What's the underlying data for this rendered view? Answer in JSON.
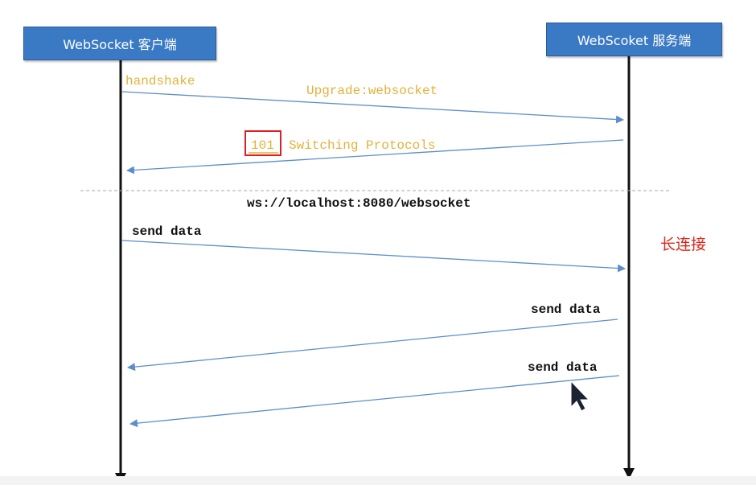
{
  "actors": {
    "client": "WebSocket 客户端",
    "server": "WebScoket 服务端"
  },
  "messages": {
    "handshake": "handshake",
    "upgrade": "Upgrade:websocket",
    "status_code": "101",
    "status_text": "Switching Protocols",
    "url": "ws://localhost:8080/websocket",
    "send1": "send data",
    "send2": "send data",
    "send3": "send data"
  },
  "note": "长连接",
  "colors": {
    "actor_fill": "#3a79c4",
    "arrow": "#5b8fc9",
    "label_yellow": "#e3b23a",
    "note_red": "#d9281c",
    "highlight": "#e02020"
  },
  "icons": {
    "cursor": "mouse-pointer-icon"
  }
}
